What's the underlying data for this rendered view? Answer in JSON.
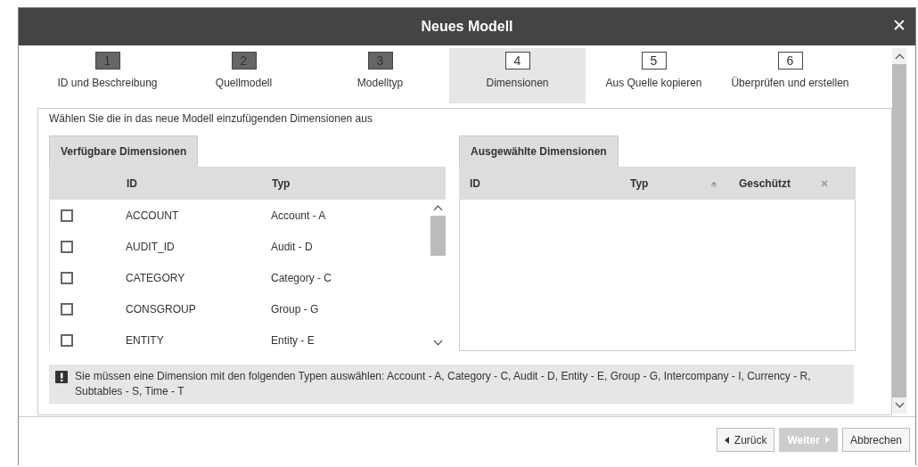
{
  "window": {
    "title": "Neues Modell",
    "close": "✕"
  },
  "steps": [
    {
      "number": "1",
      "label": "ID und Beschreibung",
      "completed": true,
      "selected": false
    },
    {
      "number": "2",
      "label": "Quellmodell",
      "completed": true,
      "selected": false
    },
    {
      "number": "3",
      "label": "Modelltyp",
      "completed": true,
      "selected": false
    },
    {
      "number": "4",
      "label": "Dimensionen",
      "completed": false,
      "selected": true
    },
    {
      "number": "5",
      "label": "Aus Quelle kopieren",
      "completed": false,
      "selected": false
    },
    {
      "number": "6",
      "label": "Überprüfen und erstellen",
      "completed": false,
      "selected": false
    }
  ],
  "instruction": "Wählen Sie die in das neue Modell einzufügenden Dimensionen aus",
  "available": {
    "tab": "Verfügbare Dimensionen",
    "columns": [
      "ID",
      "Typ"
    ],
    "rows": [
      {
        "id": "ACCOUNT",
        "type": "Account - A",
        "checked": false
      },
      {
        "id": "AUDIT_ID",
        "type": "Audit - D",
        "checked": false
      },
      {
        "id": "CATEGORY",
        "type": "Category - C",
        "checked": false
      },
      {
        "id": "CONSGROUP",
        "type": "Group - G",
        "checked": false
      },
      {
        "id": "ENTITY",
        "type": "Entity - E",
        "checked": false
      }
    ]
  },
  "selected_dimensions": {
    "tab": "Ausgewählte Dimensionen",
    "columns": [
      "ID",
      "Typ",
      "Geschützt"
    ]
  },
  "warning": "Sie müssen eine Dimension mit den folgenden Typen auswählen: Account - A, Category - C, Audit - D, Entity - E, Group - G, Intercompany - I, Currency - R, Subtables - S, Time - T",
  "buttons": [
    {
      "kind": "back",
      "label": "Zurück",
      "disabled": false
    },
    {
      "kind": "next",
      "label": "Weiter",
      "disabled": true
    },
    {
      "kind": "plain",
      "label": "Abbrechen",
      "disabled": false
    }
  ]
}
